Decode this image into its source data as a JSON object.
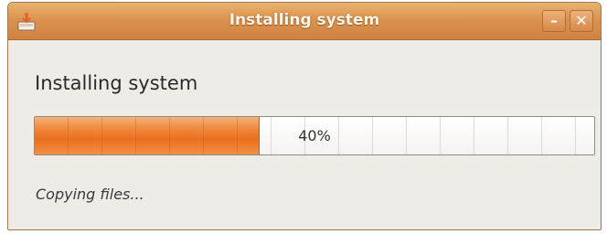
{
  "window": {
    "title": "Installing system",
    "app_icon": "installer-icon",
    "controls": {
      "minimize_label": "–",
      "close_label": "✕"
    }
  },
  "main": {
    "heading": "Installing system",
    "progress": {
      "value": 0.4,
      "label": "40%"
    },
    "status": "Copying files..."
  },
  "colors": {
    "titlebar": "#db9350",
    "progress_fill": "#ea6f1f",
    "window_background": "#efebe7"
  }
}
